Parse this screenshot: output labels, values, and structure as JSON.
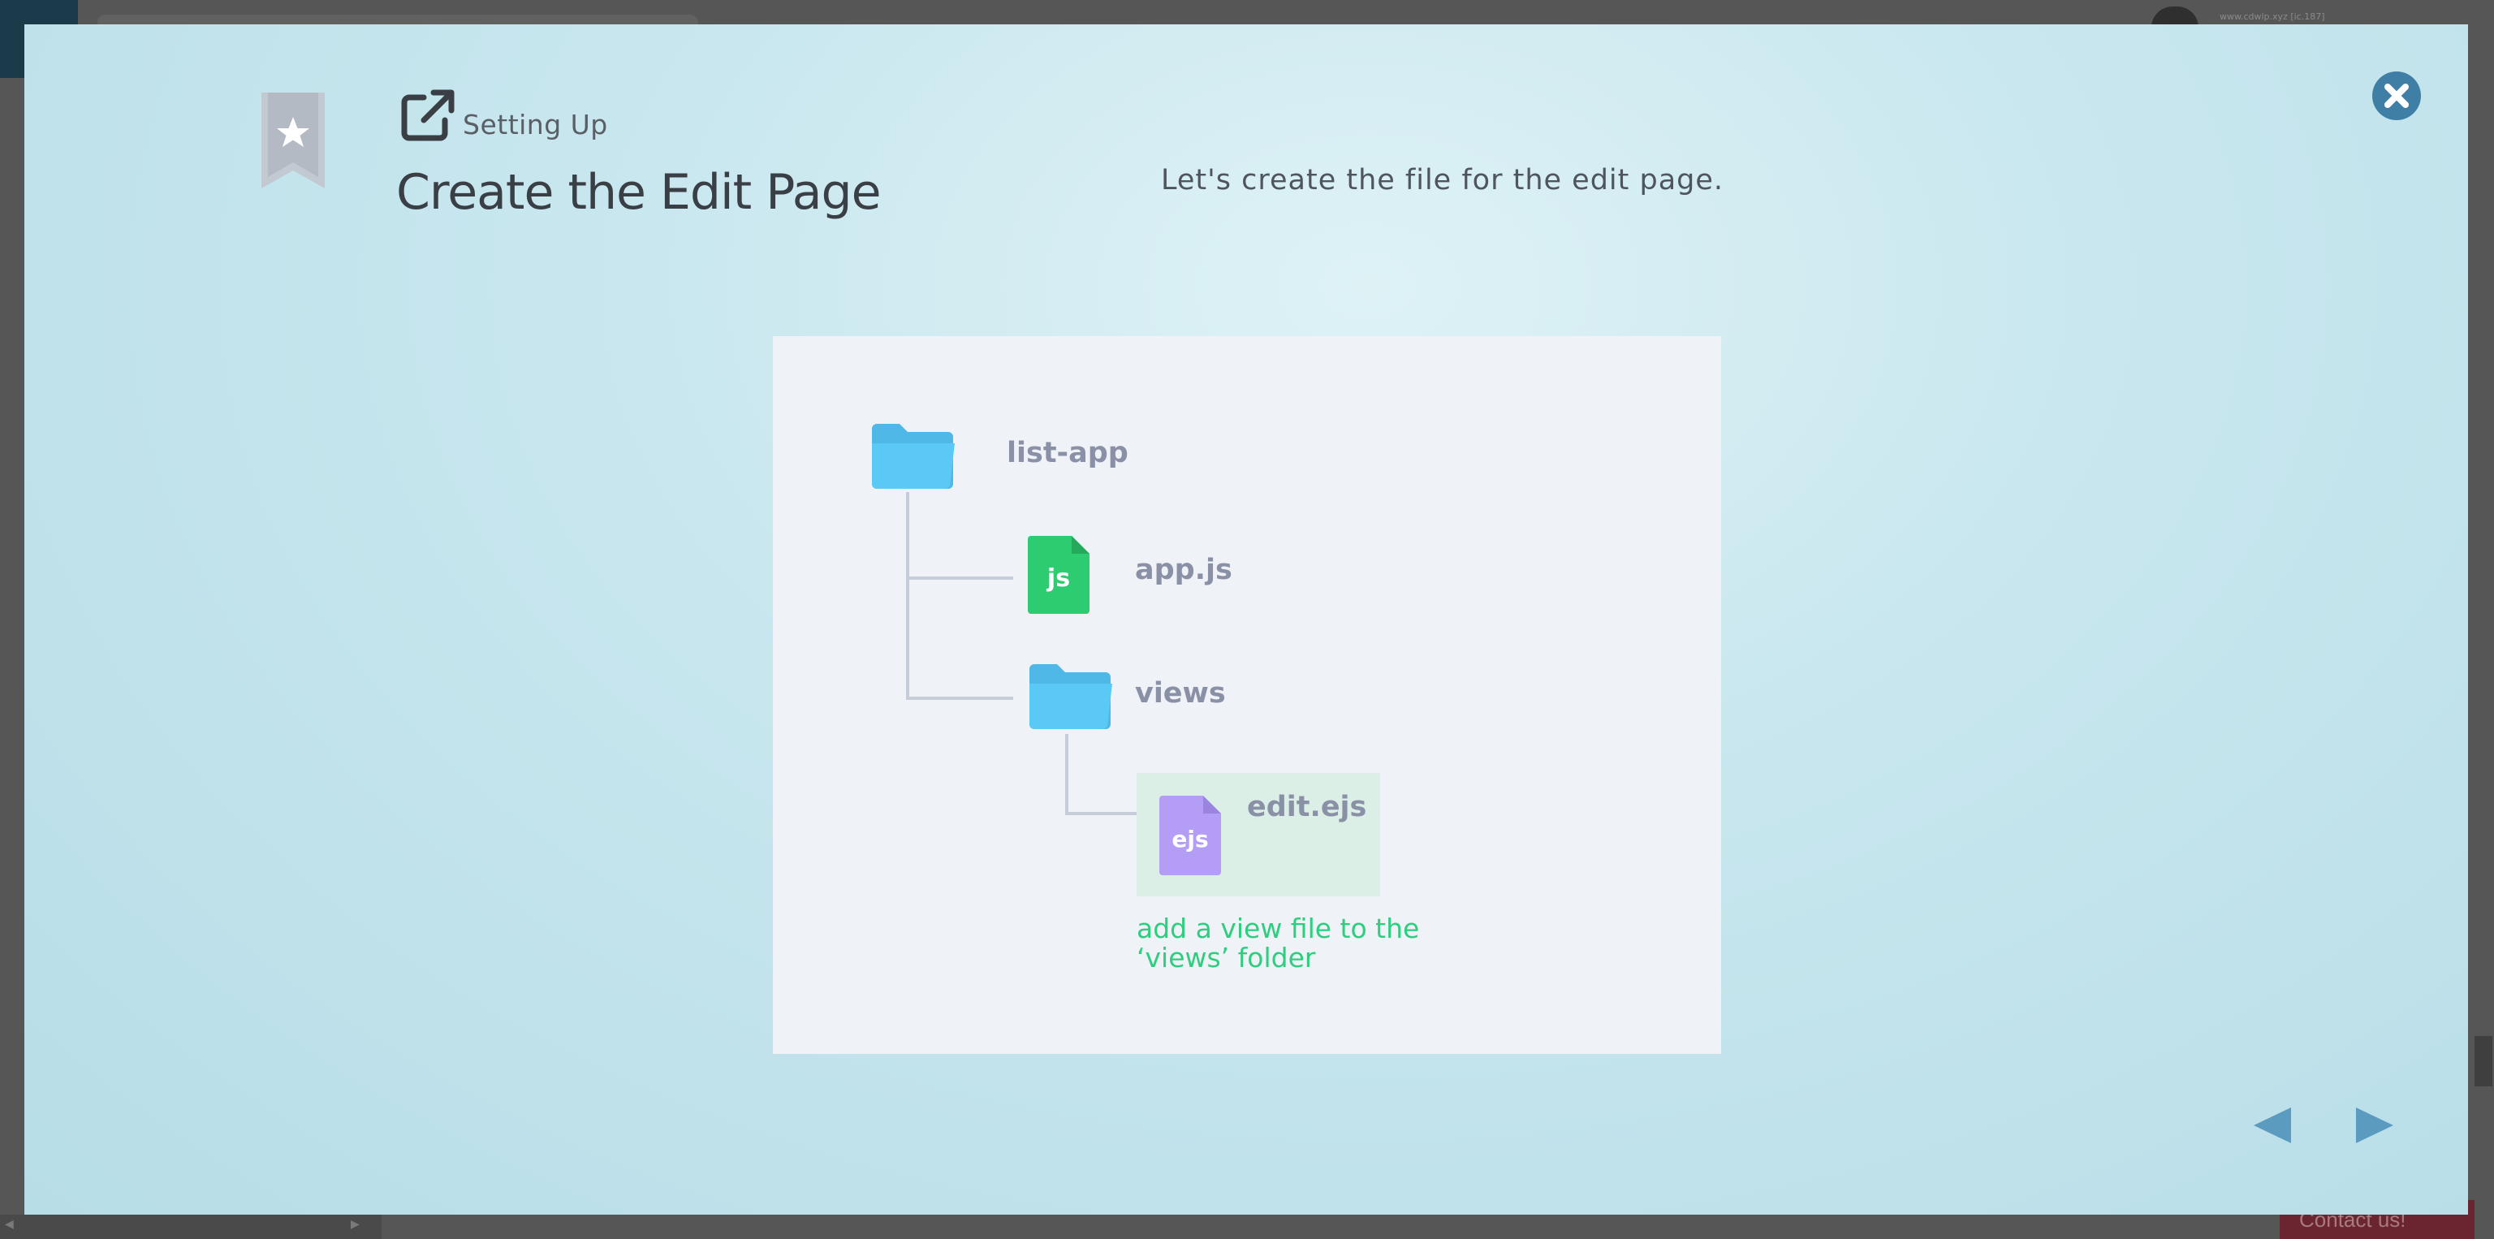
{
  "background": {
    "user_text": "www.cdwlp.xyz [ic.187]",
    "contact_label": "Contact us!"
  },
  "modal": {
    "section_label": "Setting Up",
    "title": "Create the Edit Page",
    "description": "Let's create the file for the edit page.",
    "colors": {
      "accent": "#3f7fa6",
      "nav_arrow": "#5b9bbf",
      "folder": "#5bc9f5",
      "js_file": "#2ecc71",
      "ejs_file": "#b39df5",
      "note": "#2fcd7f"
    }
  },
  "illustration": {
    "root_folder": "list-app",
    "js_file_name": "app.js",
    "js_badge": "js",
    "views_folder": "views",
    "ejs_file_name": "edit.ejs",
    "ejs_badge": "ejs",
    "note_line1": "add a view file to the",
    "note_line2": "‘views’ folder"
  },
  "icons": {
    "bookmark": "bookmark-star-icon",
    "external": "external-link-icon",
    "close": "close-icon",
    "prev": "triangle-left-icon",
    "next": "triangle-right-icon"
  }
}
